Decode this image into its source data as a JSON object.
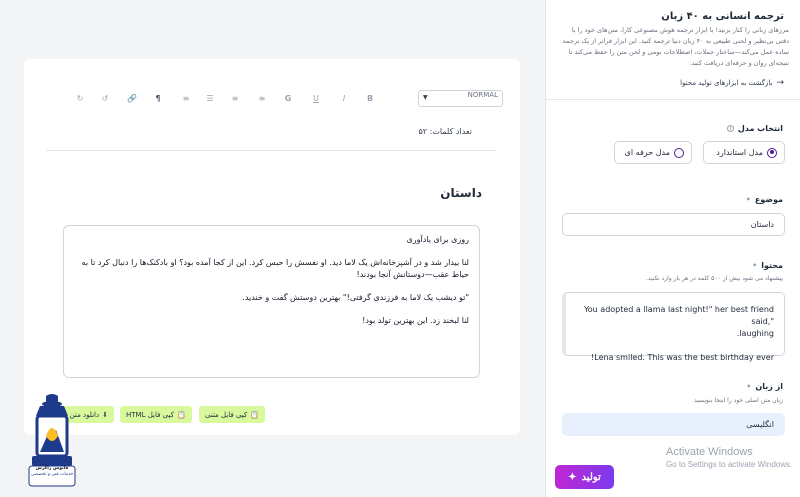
{
  "panel": {
    "title": "ترجمه انسانی به ۴۰ زبان",
    "description": "مرزهای زبانی را کنار بزنید! با ابزار ترجمه هوش مصنوعی کارا، متن‌های خود را با دقتی بی‌نظیر و لحنی طبیعی به ۴۰ زبان دنیا ترجمه کنید. این ابزار فراتر از یک ترجمه ساده عمل می‌کند—ساختار جملات، اصطلاحات بومی و لحن متن را حفظ می‌کند تا نتیجه‌ای روان و حرفه‌ای دریافت کنید.",
    "back_link": "بازگشت به ابزارهای تولید محتوا",
    "model_label": "انتخاب مدل",
    "model_standard": "مدل استاندارد",
    "model_pro": "مدل حرفه ای",
    "topic_label": "موضوع",
    "topic_value": "داستان",
    "content_label": "محتوا",
    "content_hint": "پیشنهاد می شود بیش از ۵۰۰ کلمه در هر بار وارد نکنید.",
    "content_line1": "You adopted a llama last night!\" her best friend said,\"",
    "content_line2": ".laughing",
    "content_line3": "!Lena smiled. This was the best birthday ever",
    "from_label": "از زبان",
    "from_hint": "زبان متن اصلی خود را اینجا بنویسید",
    "from_value": "انگلیسی",
    "generate_label": "تولید"
  },
  "editor": {
    "heading_value": "NORMAL",
    "word_count": "تعداد کلمات: ۵۲",
    "story_title": "داستان",
    "paragraph1": "روزی برای یادآوری",
    "paragraph2": "لنا بیدار شد و در آشپزخانه‌اش یک لاما دید. او نفسش را حبس کرد. این از کجا آمده بود؟ او بادکنک‌ها را دنبال کرد تا به حیاط عقب—دوستانش آنجا بودند!",
    "paragraph3": "\"تو دیشب یک لاما به فرزندی گرفتی!\" بهترین دوستش گفت و خندید.",
    "paragraph4": "لنا لبخند زد. این بهترین تولد بود!",
    "copy_text": "کپی فایل متنی",
    "copy_html": "کپی فایل HTML",
    "download_text": "دانلود متن"
  },
  "watermark": {
    "line1": "Activate Windows",
    "line2": "Go to Settings to activate Windows."
  },
  "logo": {
    "line1": "فانوس زاگرس",
    "line2": "خدمات فنی و تخصصی"
  },
  "colors": {
    "accent_purple": "#4c1d95",
    "generate_start": "#c026d3",
    "generate_end": "#7c3aed",
    "action_green": "#d9f99d",
    "language_field": "#e8f0fe"
  }
}
